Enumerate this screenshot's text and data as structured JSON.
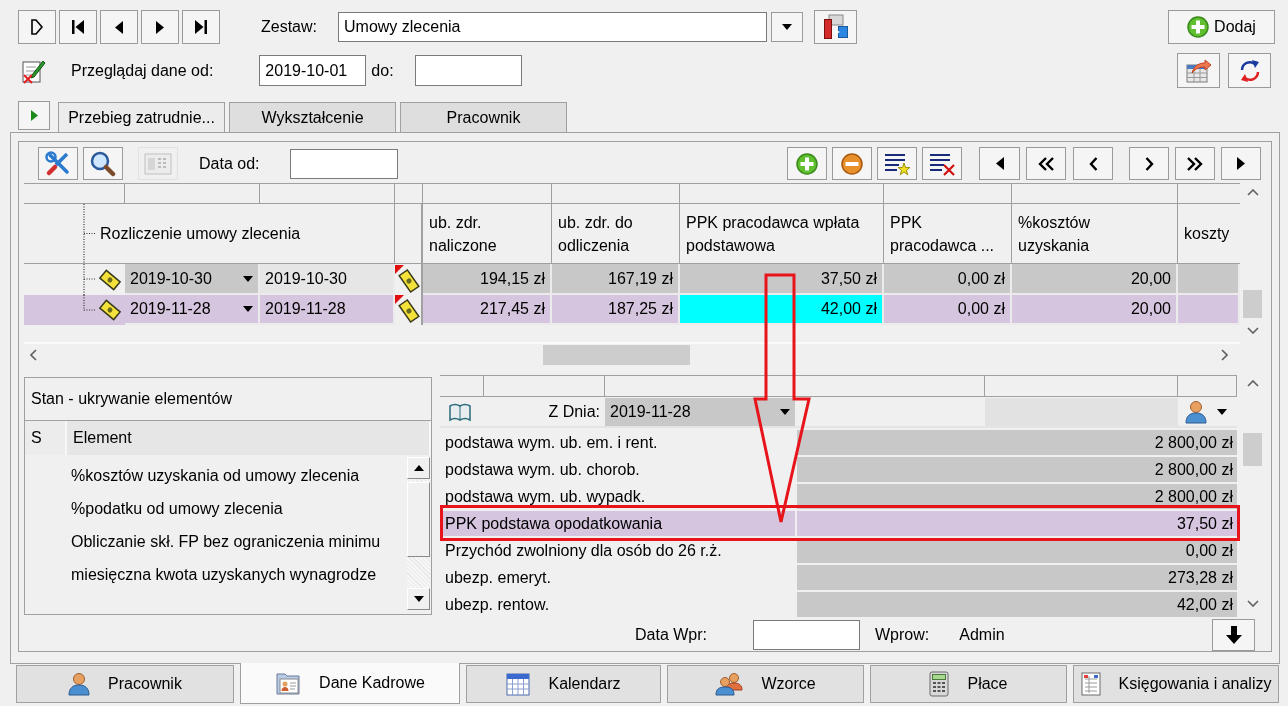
{
  "toolbar": {
    "set_label": "Zestaw:",
    "set_value": "Umowy zlecenia",
    "add_button": "Dodaj"
  },
  "filter": {
    "from_label": "Przeglądaj dane od:",
    "from_value": "2019-10-01",
    "to_label": "do:"
  },
  "tabs": [
    {
      "label": "Przebieg zatrudnie...",
      "selected": true
    },
    {
      "label": "Wykształcenie",
      "selected": false
    },
    {
      "label": "Pracownik",
      "selected": false
    }
  ],
  "grid_toolbar": {
    "date_label": "Data od:",
    "keypad_button": {
      "disabled": true
    }
  },
  "grid": {
    "tree_header": "Rozliczenie umowy zlecenia",
    "columns": [
      "ub. zdr. naliczone",
      "ub. zdr. do odliczenia",
      "PPK pracodawca wpłata podstawowa",
      "PPK pracodawca ...",
      "%kosztów uzyskania",
      "koszty"
    ],
    "rows": [
      {
        "selected": false,
        "date_from": "2019-10-30",
        "date_to": "2019-10-30",
        "cells": [
          {
            "text": "194,15 zł",
            "focused": false
          },
          {
            "text": "167,19 zł",
            "focused": false
          },
          {
            "text": "37,50 zł",
            "focused": false
          },
          {
            "text": "0,00 zł",
            "focused": false
          },
          {
            "text": "20,00",
            "focused": false
          }
        ]
      },
      {
        "selected": true,
        "date_from": "2019-11-28",
        "date_to": "2019-11-28",
        "cells": [
          {
            "text": "217,45 zł",
            "focused": false
          },
          {
            "text": "187,25 zł",
            "focused": false
          },
          {
            "text": "42,00 zł",
            "focused": true
          },
          {
            "text": "0,00 zł",
            "focused": false
          },
          {
            "text": "20,00",
            "focused": false
          }
        ]
      }
    ]
  },
  "state_panel": {
    "title": "Stan - ukrywanie elementów",
    "columns": [
      "S",
      "Element"
    ],
    "items": [
      "%kosztów uzyskania od umowy zlecenia",
      "%podatku od umowy zlecenia",
      "Obliczanie skł. FP bez ograniczenia minimu",
      "miesięczna kwota uzyskanych wynagrodze"
    ]
  },
  "details": {
    "date_label": "Z Dnia:",
    "date": "2019-11-28",
    "rows": [
      {
        "label": "podstawa wym. ub. em. i rent.",
        "value": "2 800,00 zł",
        "selected": false
      },
      {
        "label": "podstawa wym. ub. chorob.",
        "value": "2 800,00 zł",
        "selected": false
      },
      {
        "label": "podstawa wym. ub. wypadk.",
        "value": "2 800,00 zł",
        "selected": false
      },
      {
        "label": "PPK podstawa opodatkowania",
        "value": "37,50 zł",
        "selected": true
      },
      {
        "label": "Przychód zwolniony dla osób do 26 r.ż.",
        "value": "0,00 zł",
        "selected": false
      },
      {
        "label": "ubezp. emeryt.",
        "value": "273,28 zł",
        "selected": false
      },
      {
        "label": "ubezp. rentow.",
        "value": "42,00 zł",
        "selected": false
      }
    ]
  },
  "footer": {
    "entry_date_label": "Data Wpr:",
    "entered_by_label": "Wprow:",
    "entered_by": "Admin"
  },
  "bottom_tabs": [
    {
      "label": "Pracownik",
      "selected": false
    },
    {
      "label": "Dane Kadrowe",
      "selected": true
    },
    {
      "label": "Kalendarz",
      "selected": false
    },
    {
      "label": "Wzorce",
      "selected": false
    },
    {
      "label": "Płace",
      "selected": false
    },
    {
      "label": "Księgowania i analizy",
      "selected": false
    }
  ]
}
